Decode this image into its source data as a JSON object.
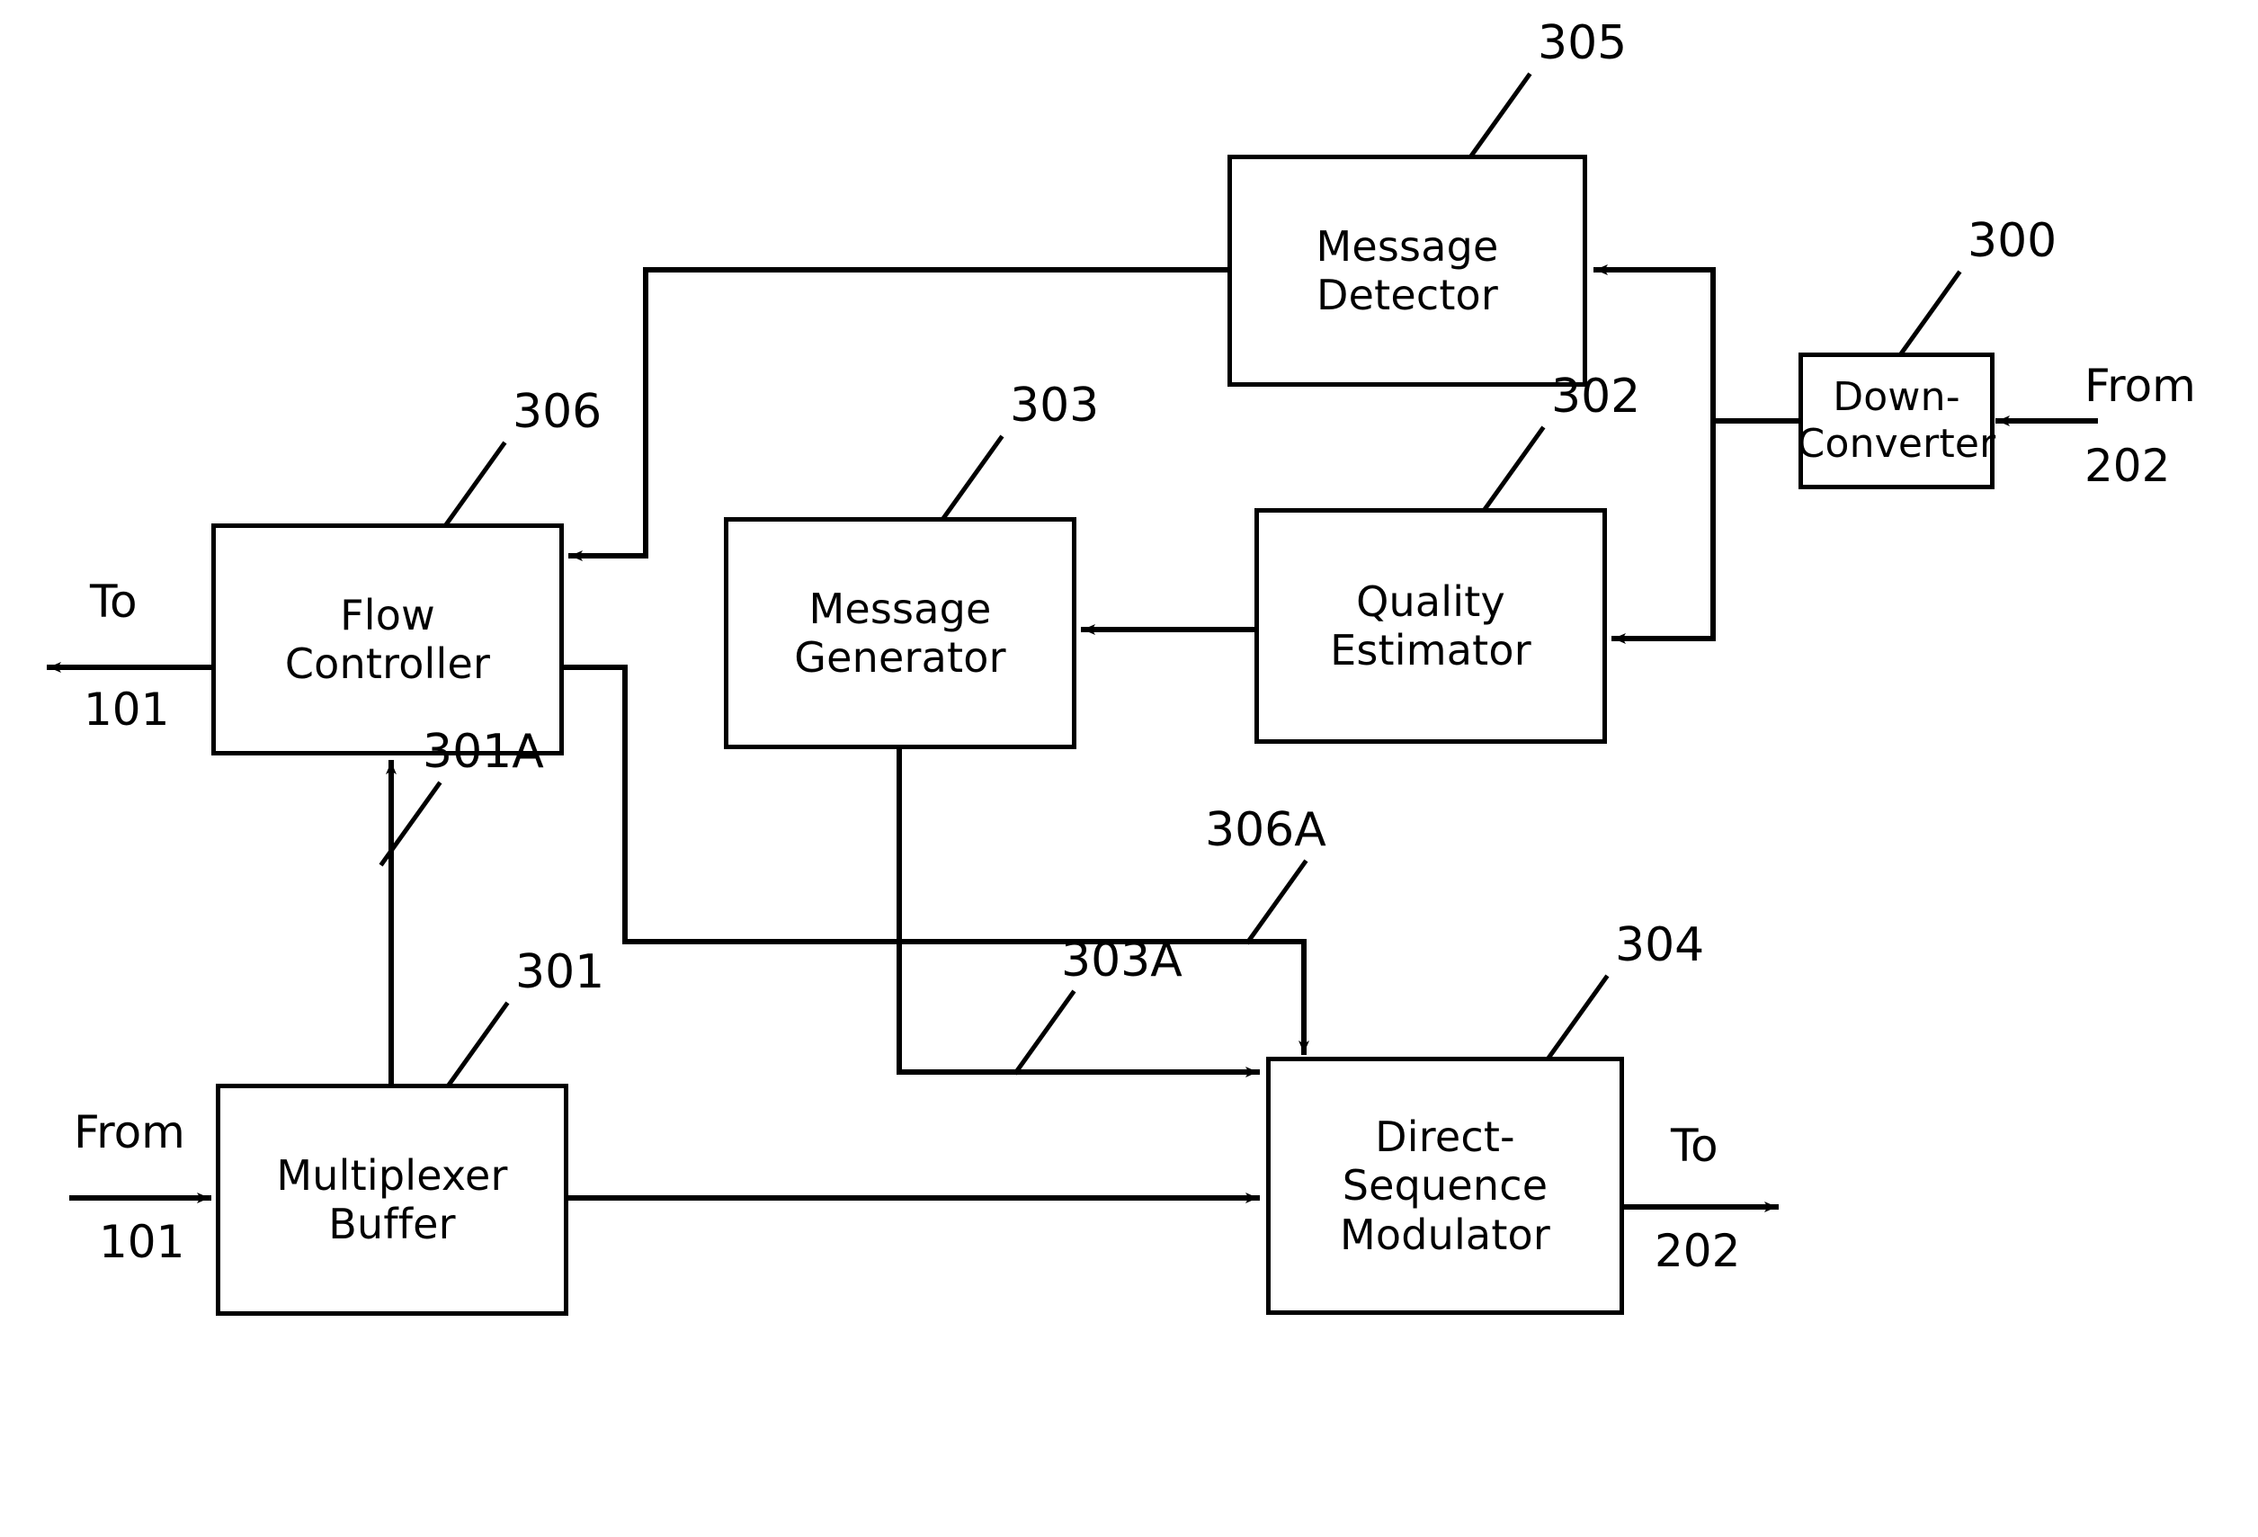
{
  "figure": {
    "type": "patent-block-diagram",
    "background": "#ffffff",
    "line_color": "#000000"
  },
  "blocks": [
    {
      "id": "message-detector",
      "label": "Message\nDetector",
      "ref": "305"
    },
    {
      "id": "down-converter",
      "label": "Down-\nConverter",
      "ref": "300"
    },
    {
      "id": "flow-controller",
      "label": "Flow\nController",
      "ref": "306"
    },
    {
      "id": "message-generator",
      "label": "Message\nGenerator",
      "ref": "303"
    },
    {
      "id": "quality-estimator",
      "label": "Quality\nEstimator",
      "ref": "302"
    },
    {
      "id": "multiplexer-buffer",
      "label": "Multiplexer\nBuffer",
      "ref": "301"
    },
    {
      "id": "ds-modulator",
      "label": "Direct-\nSequence\nModulator",
      "ref": "304"
    }
  ],
  "signal_refs": [
    {
      "id": "ref-301a",
      "text": "301A"
    },
    {
      "id": "ref-303a",
      "text": "303A"
    },
    {
      "id": "ref-306a",
      "text": "306A"
    }
  ],
  "io_labels": [
    {
      "id": "flow-out",
      "direction": "To",
      "node": "101"
    },
    {
      "id": "mux-in",
      "direction": "From",
      "node": "101"
    },
    {
      "id": "downconv-in",
      "direction": "From",
      "node": "202"
    },
    {
      "id": "modulator-out",
      "direction": "To",
      "node": "202"
    }
  ]
}
